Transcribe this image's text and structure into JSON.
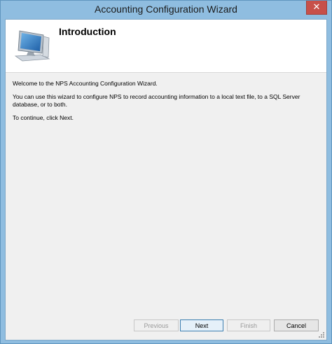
{
  "window": {
    "title": "Accounting Configuration Wizard",
    "close_glyph": "✕"
  },
  "header": {
    "title": "Introduction",
    "icon": "computer-monitor-icon"
  },
  "body": {
    "welcome": "Welcome to the NPS Accounting Configuration Wizard.",
    "description": "You can use this wizard to configure NPS to record accounting information to a local text file, to a SQL Server database, or to both.",
    "instruction": "To continue, click Next."
  },
  "buttons": {
    "previous": "Previous",
    "next": "Next",
    "finish": "Finish",
    "cancel": "Cancel"
  },
  "colors": {
    "titlebar": "#8fbde0",
    "close_button": "#c7504a",
    "client_background": "#f0f0f0"
  }
}
